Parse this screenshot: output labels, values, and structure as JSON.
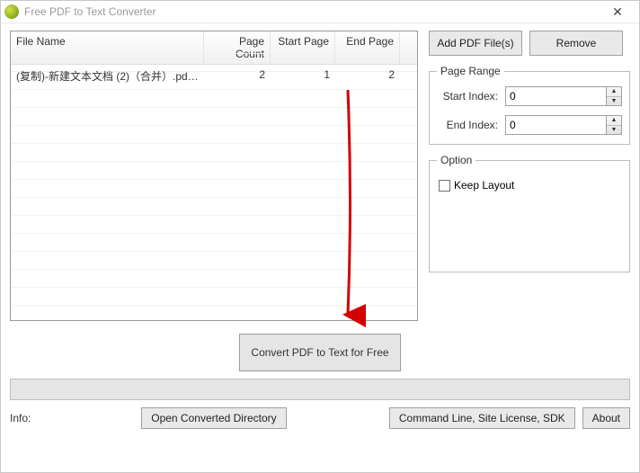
{
  "window": {
    "title": "Free PDF to Text Converter"
  },
  "table": {
    "headers": {
      "file_name": "File Name",
      "page_count": "Page Count",
      "start_page": "Start Page",
      "end_page": "End Page"
    },
    "rows": [
      {
        "file_name": "(复制)-新建文本文档 (2)（合并）.pdf-...",
        "page_count": "2",
        "start_page": "1",
        "end_page": "2"
      }
    ]
  },
  "buttons": {
    "add": "Add PDF File(s)",
    "remove": "Remove",
    "convert": "Convert PDF to Text for Free",
    "open_dir": "Open Converted Directory",
    "cmdline": "Command Line, Site License, SDK",
    "about": "About"
  },
  "page_range": {
    "legend": "Page Range",
    "start_label": "Start Index:",
    "end_label": "End Index:",
    "start_value": "0",
    "end_value": "0"
  },
  "option": {
    "legend": "Option",
    "keep_layout": "Keep Layout"
  },
  "info_label": "Info:",
  "icons": {
    "close": "✕",
    "up": "▲",
    "down": "▼"
  }
}
